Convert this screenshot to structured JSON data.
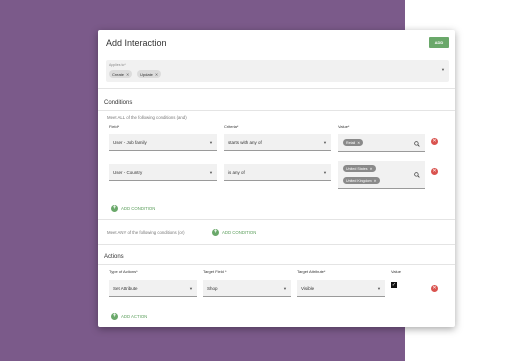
{
  "dialog": {
    "title": "Add Interaction",
    "add_label": "ADD"
  },
  "applies": {
    "label": "Applies to*",
    "chips": [
      "Create",
      "Update"
    ]
  },
  "conditions": {
    "title": "Conditions",
    "meet_all": "Meet ALL of the following conditions (and)",
    "headers": {
      "field": "Field*",
      "criteria": "Criteria*",
      "value": "Value*"
    },
    "rows": [
      {
        "field": "User - Job family",
        "criteria": "starts with any of",
        "values": [
          "Retail"
        ]
      },
      {
        "field": "User - Country",
        "criteria": "is any of",
        "values": [
          "United States",
          "United Kingdom"
        ]
      }
    ],
    "add_condition": "ADD CONDITION",
    "meet_any": "Meet ANY of the following conditions (or)",
    "add_condition_any": "ADD CONDITION"
  },
  "actions": {
    "title": "Actions",
    "headers": {
      "type": "Type of Actions*",
      "target_field": "Target Field *",
      "target_attribute": "Target Attribute*",
      "value": "Value"
    },
    "row": {
      "type": "Set Attribute",
      "target_field": "Shop",
      "target_attribute": "Visible",
      "value_checked": true
    },
    "add_action": "ADD ACTION"
  },
  "colors": {
    "accent": "#6aa86a",
    "delete": "#d9534f",
    "backdrop": "#7b5a8a"
  }
}
